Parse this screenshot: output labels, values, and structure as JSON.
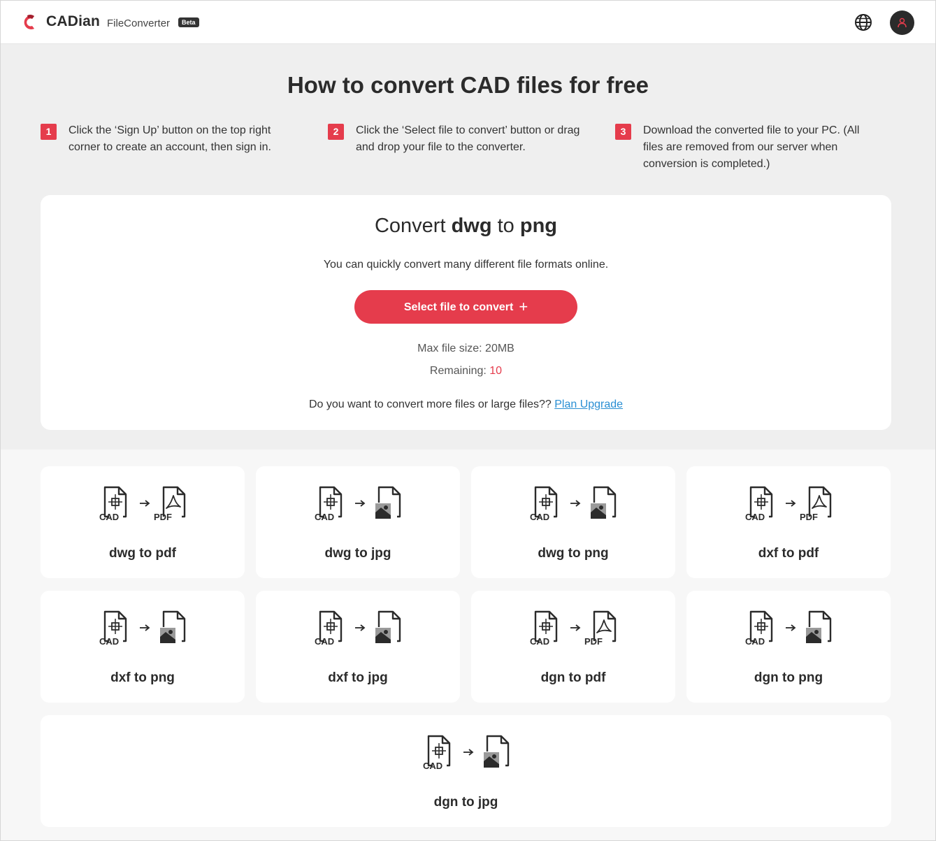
{
  "header": {
    "brand": "CADian",
    "product": "FileConverter",
    "badge": "Beta"
  },
  "hero": {
    "title": "How to convert CAD files for free",
    "steps": [
      {
        "num": "1",
        "text": "Click the ‘Sign Up’ button on the top right corner to create an account, then sign in."
      },
      {
        "num": "2",
        "text": "Click the ‘Select file to convert’ button or drag and drop your file to the converter."
      },
      {
        "num": "3",
        "text": "Download the converted file to your PC. (All files are removed from our server when conversion is completed.)"
      }
    ]
  },
  "converter": {
    "title_prefix": "Convert ",
    "from": "dwg",
    "title_mid": " to ",
    "to": "png",
    "subtitle": "You can quickly convert many different file formats online.",
    "button_label": "Select file to convert",
    "button_icon": "+",
    "max_size": "Max file size: 20MB",
    "remaining_label": "Remaining: ",
    "remaining_value": "10",
    "upgrade_text": "Do you want to convert more files or large files?? ",
    "upgrade_link": "Plan Upgrade"
  },
  "formats": [
    {
      "label": "dwg to pdf",
      "target": "pdf"
    },
    {
      "label": "dwg to jpg",
      "target": "image"
    },
    {
      "label": "dwg to png",
      "target": "image"
    },
    {
      "label": "dxf to pdf",
      "target": "pdf"
    },
    {
      "label": "dxf to png",
      "target": "image"
    },
    {
      "label": "dxf to jpg",
      "target": "image"
    },
    {
      "label": "dgn to pdf",
      "target": "pdf"
    },
    {
      "label": "dgn to png",
      "target": "image"
    },
    {
      "label": "dgn to jpg",
      "target": "image"
    }
  ],
  "icon_text": {
    "cad": "CAD",
    "pdf": "PDF"
  },
  "colors": {
    "accent": "#e53c4c",
    "link": "#2a8fd3",
    "dark": "#2b2b2b"
  }
}
